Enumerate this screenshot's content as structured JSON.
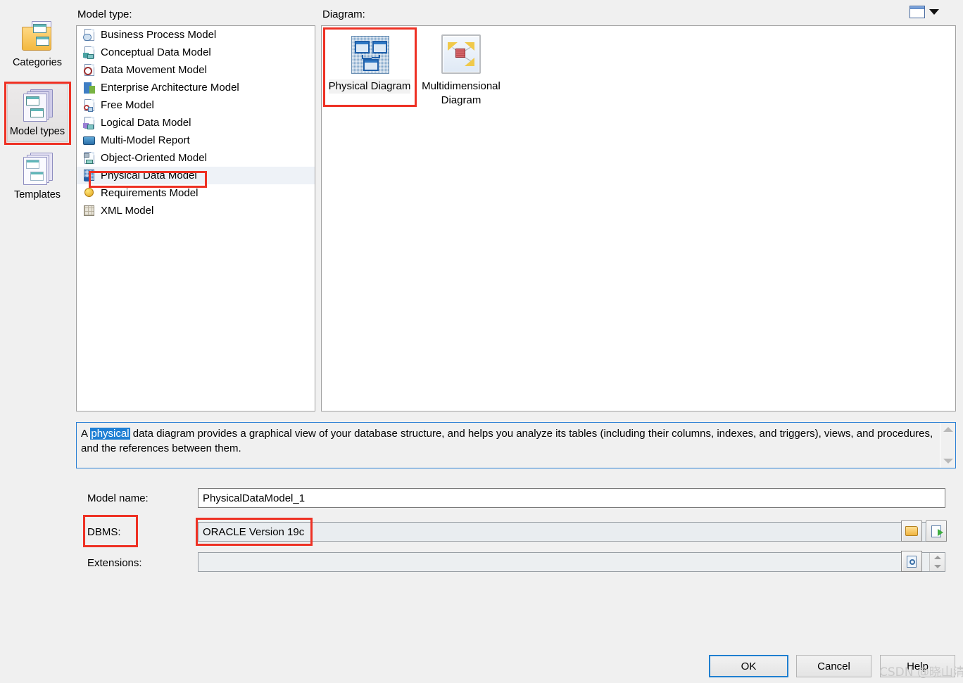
{
  "window": {
    "view_toggle_icon": "grid-view-icon",
    "view_toggle_caret": "chevron-down-icon"
  },
  "sidebar": {
    "items": [
      {
        "label": "Categories",
        "icon": "folder-pages-icon",
        "selected": false
      },
      {
        "label": "Model types",
        "icon": "stacked-windows-icon",
        "selected": true
      },
      {
        "label": "Templates",
        "icon": "stacked-pages-icon",
        "selected": false
      }
    ]
  },
  "model_type": {
    "label": "Model type:",
    "items": [
      {
        "label": "Business Process Model",
        "selected": false
      },
      {
        "label": "Conceptual Data Model",
        "selected": false
      },
      {
        "label": "Data Movement Model",
        "selected": false
      },
      {
        "label": "Enterprise Architecture Model",
        "selected": false
      },
      {
        "label": "Free Model",
        "selected": false
      },
      {
        "label": "Logical Data Model",
        "selected": false
      },
      {
        "label": "Multi-Model Report",
        "selected": false
      },
      {
        "label": "Object-Oriented Model",
        "selected": false
      },
      {
        "label": "Physical Data Model",
        "selected": true
      },
      {
        "label": "Requirements Model",
        "selected": false
      },
      {
        "label": "XML Model",
        "selected": false
      }
    ]
  },
  "diagram": {
    "label": "Diagram:",
    "items": [
      {
        "label": "Physical Diagram",
        "icon": "physical-diagram-icon",
        "selected": true
      },
      {
        "label": "Multidimensional Diagram",
        "icon": "multidimensional-diagram-icon",
        "selected": false
      }
    ]
  },
  "description": {
    "prefix": "A ",
    "highlight": "physical",
    "rest": " data diagram provides a graphical view of your database structure, and helps you analyze its tables (including their columns, indexes, and triggers), views, and procedures, and the references between them.",
    "scroll_up_icon": "chevron-up-icon",
    "scroll_down_icon": "chevron-down-icon"
  },
  "form": {
    "model_name_label": "Model name:",
    "model_name_value": "PhysicalDataModel_1",
    "dbms_label": "DBMS:",
    "dbms_value": "ORACLE Version 19c",
    "dbms_dropdown_icon": "chevron-down-icon",
    "dbms_browse_icon": "folder-open-icon",
    "dbms_share_icon": "page-arrow-icon",
    "extensions_label": "Extensions:",
    "extensions_value": "",
    "extensions_spinner_icon": "spinner-icon",
    "extensions_browse_icon": "page-search-icon"
  },
  "footer": {
    "ok_label": "OK",
    "cancel_label": "Cancel",
    "help_label": "Help"
  },
  "watermark": {
    "text": "CSDN @晓山清"
  },
  "colors": {
    "accent_red": "#ee3124",
    "selection_blue": "#1e7fd4",
    "focus_border": "#1f7fd0",
    "panel_bg": "#f0f0f0"
  }
}
